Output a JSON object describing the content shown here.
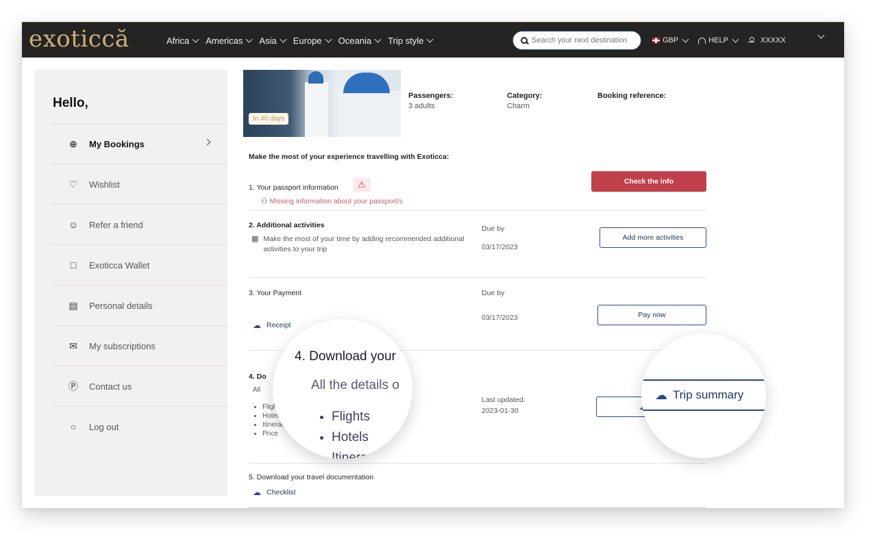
{
  "brand": {
    "logo_text": "exoticcă"
  },
  "nav": {
    "items": [
      {
        "label": "Africa"
      },
      {
        "label": "Americas"
      },
      {
        "label": "Asia"
      },
      {
        "label": "Europe"
      },
      {
        "label": "Oceania"
      },
      {
        "label": "Trip style"
      }
    ],
    "search_placeholder": "Search your next destination",
    "currency": "GBP",
    "help": "HELP",
    "user": "XXXXX"
  },
  "sidebar": {
    "greeting": "Hello,",
    "items": [
      {
        "label": "My Bookings",
        "icon": "globe-plane-icon",
        "active": true
      },
      {
        "label": "Wishlist",
        "icon": "heart-icon"
      },
      {
        "label": "Refer a friend",
        "icon": "add-user-icon"
      },
      {
        "label": "Exoticca Wallet",
        "icon": "wallet-icon"
      },
      {
        "label": "Personal details",
        "icon": "id-card-icon"
      },
      {
        "label": "My subscriptions",
        "icon": "mail-icon"
      },
      {
        "label": "Contact us",
        "icon": "question-icon"
      },
      {
        "label": "Log out",
        "icon": "logout-icon"
      }
    ]
  },
  "booking": {
    "badge": "In 40 days",
    "passengers_label": "Passengers:",
    "passengers_value": "3 adults",
    "category_label": "Category:",
    "category_value": "Charm",
    "reference_label": "Booking reference:",
    "intro": "Make the most of your experience travelling with Exoticca:"
  },
  "steps": {
    "passport": {
      "title": "1. Your passport information",
      "warning": "Missing information about your passport/s",
      "button": "Check the info"
    },
    "activities": {
      "title": "2. Additional activities",
      "desc": "Make the most of your time by adding recommended additional activities to your trip",
      "due_label": "Due by",
      "due_date": "03/17/2023",
      "button": "Add more activities"
    },
    "payment": {
      "title": "3. Your Payment",
      "receipt": "Receipt",
      "due_label": "Due by",
      "due_date": "03/17/2023",
      "button": "Pay now"
    },
    "download": {
      "title": "4. Download your",
      "title_short": "4. Do",
      "desc": "All the details o",
      "desc_short": "All",
      "bullets": [
        "Flights",
        "Hotels",
        "Itinerary",
        "Price"
      ],
      "updated_label": "Last updated:",
      "updated_value": "2023-01-30",
      "button": "Trip summary",
      "button_short": "Trip"
    },
    "documentation": {
      "title": "5. Download your travel documentation",
      "link": "Checklist"
    }
  }
}
